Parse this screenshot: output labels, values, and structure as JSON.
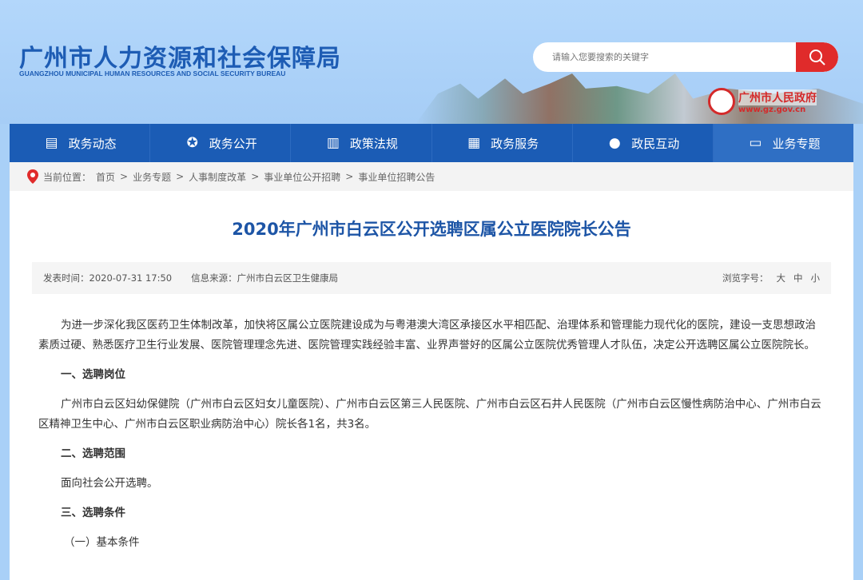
{
  "header": {
    "title_cn": "广州市人力资源和社会保障局",
    "title_en": "GUANGZHOU MUNICIPAL HUMAN RESOURCES AND SOCIAL SECURITY BUREAU",
    "search_placeholder": "请输入您要搜索的关键字",
    "gov_name": "广州市人民政府",
    "gov_url": "www.gz.gov.cn"
  },
  "nav": [
    {
      "label": "政务动态",
      "icon": "newspaper-icon"
    },
    {
      "label": "政务公开",
      "icon": "star-icon"
    },
    {
      "label": "政策法规",
      "icon": "book-icon"
    },
    {
      "label": "政务服务",
      "icon": "document-icon"
    },
    {
      "label": "政民互动",
      "icon": "chat-icon"
    },
    {
      "label": "业务专题",
      "icon": "list-icon"
    }
  ],
  "breadcrumb": {
    "label": "当前位置：",
    "items": [
      "首页",
      "业务专题",
      "人事制度改革",
      "事业单位公开招聘",
      "事业单位招聘公告"
    ],
    "sep": ">"
  },
  "article": {
    "title": "2020年广州市白云区公开选聘区属公立医院院长公告",
    "publish_time": "发表时间：2020-07-31 17:50",
    "source": "信息来源：广州市白云区卫生健康局",
    "font_label": "浏览字号：",
    "font_sizes": [
      "大",
      "中",
      "小"
    ],
    "paragraphs": [
      "为进一步深化我区医药卫生体制改革，加快将区属公立医院建设成为与粤港澳大湾区承接区水平相匹配、治理体系和管理能力现代化的医院，建设一支思想政治素质过硬、熟悉医疗卫生行业发展、医院管理理念先进、医院管理实践经验丰富、业界声誉好的区属公立医院优秀管理人才队伍，决定公开选聘区属公立医院院长。",
      "一、选聘岗位",
      "广州市白云区妇幼保健院（广州市白云区妇女儿童医院）、广州市白云区第三人民医院、广州市白云区石井人民医院（广州市白云区慢性病防治中心、广州市白云区精神卫生中心、广州市白云区职业病防治中心）院长各1名，共3名。",
      "二、选聘范围",
      "面向社会公开选聘。",
      "三、选聘条件",
      "（一）基本条件"
    ]
  }
}
